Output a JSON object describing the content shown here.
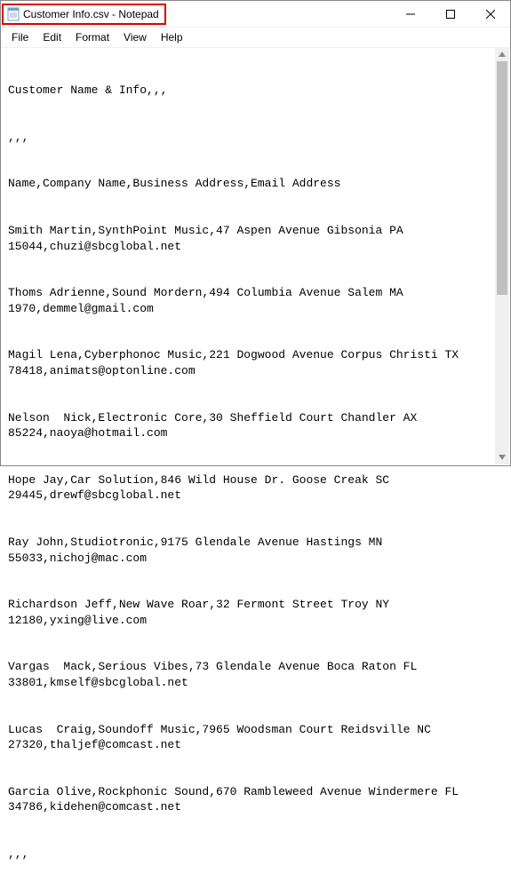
{
  "window": {
    "title": "Customer Info.csv - Notepad"
  },
  "menu": {
    "file": "File",
    "edit": "Edit",
    "format": "Format",
    "view": "View",
    "help": "Help"
  },
  "lines": [
    "Customer Name & Info,,,",
    ",,,",
    "Name,Company Name,Business Address,Email Address",
    "Smith Martin,SynthPoint Music,47 Aspen Avenue Gibsonia PA 15044,chuzi@sbcglobal.net",
    "Thoms Adrienne,Sound Mordern,494 Columbia Avenue Salem MA 1970,demmel@gmail.com",
    "Magil Lena,Cyberphonoc Music,221 Dogwood Avenue Corpus Christi TX 78418,animats@optonline.com",
    "Nelson  Nick,Electronic Core,30 Sheffield Court Chandler AX 85224,naoya@hotmail.com",
    "Hope Jay,Car Solution,846 Wild House Dr. Goose Creak SC 29445,drewf@sbcglobal.net",
    "Ray John,Studiotronic,9175 Glendale Avenue Hastings MN 55033,nichoj@mac.com",
    "Richardson Jeff,New Wave Roar,32 Fermont Street Troy NY 12180,yxing@live.com",
    "Vargas  Mack,Serious Vibes,73 Glendale Avenue Boca Raton FL 33801,kmself@sbcglobal.net",
    "Lucas  Craig,Soundoff Music,7965 Woodsman Court Reidsville NC 27320,thaljef@comcast.net",
    "Garcia Olive,Rockphonic Sound,670 Rambleweed Avenue Windermere FL 34786,kidehen@comcast.net",
    ",,,"
  ]
}
